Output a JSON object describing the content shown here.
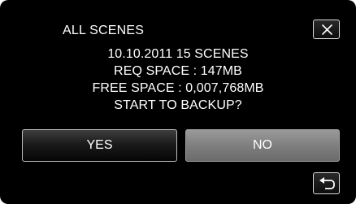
{
  "dialog": {
    "title": "ALL SCENES",
    "message_lines": [
      "10.10.2011 15 SCENES",
      "REQ SPACE : 147MB",
      "FREE SPACE : 0,007,768MB",
      "START TO BACKUP?"
    ],
    "yes_label": "YES",
    "no_label": "NO"
  },
  "icons": {
    "close": "close-icon",
    "back": "return-icon"
  },
  "colors": {
    "background": "#000000",
    "text": "#ffffff",
    "selected_button": "#7f7f7f"
  }
}
